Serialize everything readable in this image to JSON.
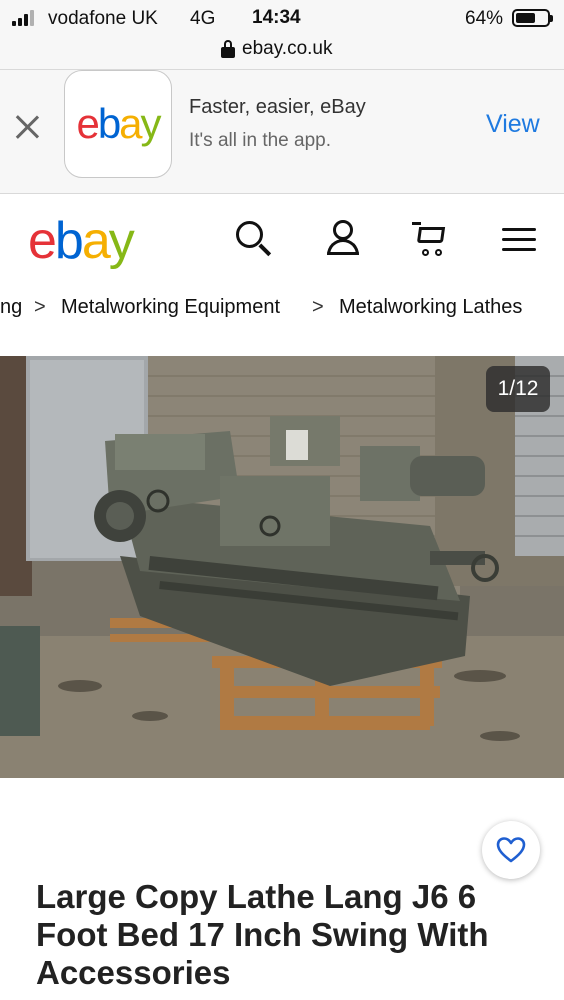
{
  "status_bar": {
    "carrier": "vodafone UK",
    "network": "4G",
    "time": "14:34",
    "battery_percent": "64%",
    "battery_level": 0.64
  },
  "url_bar": {
    "url": "ebay.co.uk",
    "icon": "lock-icon"
  },
  "app_banner": {
    "title": "Faster, easier, eBay",
    "subtitle": "It's all in the app.",
    "action_label": "View",
    "action_color": "#1f7ae0",
    "close_icon": "close-icon",
    "logo_letters": [
      "e",
      "b",
      "a",
      "y"
    ]
  },
  "brand": {
    "logo_letters": [
      "e",
      "b",
      "a",
      "y"
    ],
    "colors": {
      "e": "#e53238",
      "b": "#0064d2",
      "a": "#f5af02",
      "y": "#86b817"
    }
  },
  "header": {
    "icons": [
      "search-icon",
      "user-icon",
      "cart-icon",
      "menu-icon"
    ]
  },
  "breadcrumb": {
    "items": [
      "ng",
      "Metalworking Equipment",
      "Metalworking Lathes"
    ],
    "separator": ">"
  },
  "gallery": {
    "counter": "1/12"
  },
  "item": {
    "title": "Large Copy Lathe Lang J6 6 Foot Bed 17 Inch Swing With Accessories",
    "watch_icon": "heart-icon"
  }
}
